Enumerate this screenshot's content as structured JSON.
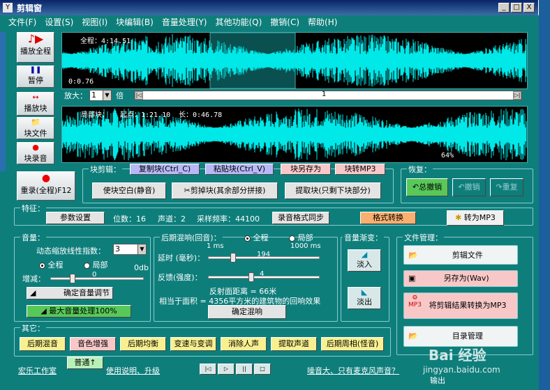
{
  "window": {
    "title": "剪辑窗",
    "app_icon": "Y",
    "min": "_",
    "max": "□",
    "close": "X"
  },
  "menu": [
    "文件(F)",
    "设置(S)",
    "视图(I)",
    "块编辑(B)",
    "音量处理(Y)",
    "其他功能(Q)",
    "撤销(C)",
    "帮助(H)"
  ],
  "side_buttons": {
    "play_all": "播放全程",
    "pause": "暂停",
    "play_block": "播放块",
    "block_file": "块文件",
    "block_record": "块录音"
  },
  "wave_full": {
    "total_label": "全程：4:14.51",
    "position": "0:0.76"
  },
  "zoom": {
    "label": "放大：",
    "value": "1",
    "unit": "倍",
    "scroll_value": "1"
  },
  "wave_block": {
    "label": "局部块：",
    "start_label": "起点：1:21.10",
    "length_label": "长：0:46.78",
    "percent": "64%"
  },
  "rerecord": "重录(全程)F12",
  "block_edit": {
    "label": "块剪辑：",
    "copy": "复制块(Ctrl_C)",
    "paste": "粘贴块(Ctrl_V)",
    "save_as": "块另存为",
    "to_mp3": "块转MP3",
    "blank": "使块空白(静音)",
    "cut": "剪掉块(其余部分拼接)",
    "extract": "提取块(只剩下块部分)"
  },
  "restore": {
    "label": "恢复：",
    "undo_all": "总撤销",
    "undo": "撤销",
    "redo": "重复"
  },
  "features": {
    "label": "特征：",
    "params_btn": "参数设置",
    "bits": "位数：16",
    "channels": "声道：2",
    "sample_rate": "采样频率：44100",
    "sync_btn": "录音格式同步",
    "format_btn": "格式转换",
    "mp3_btn": "转为MP3"
  },
  "volume": {
    "label": "音量：",
    "dyn_label": "动态缩放线性指数：",
    "dyn_value": "3",
    "all": "全程",
    "partial": "局部",
    "gain_label": "增减：",
    "gain_value": "0",
    "db_label": "0db",
    "confirm_btn": "确定音量调节",
    "max_btn": "最大音量处理100%"
  },
  "reverb": {
    "label": "后期混响(回音)：",
    "all": "全程",
    "partial": "局部",
    "min_ms": "1 ms",
    "max_ms": "1000 ms",
    "delay_label": "延时 (毫秒)：",
    "delay_value": "194",
    "feedback_label": "反馈(强度)：",
    "feedback_value": "4",
    "distance_text": "反射面距离 = 66米",
    "area_text": "相当于面积 = 4356平方米的建筑物的回响效果",
    "confirm_btn": "确定混响"
  },
  "fade": {
    "label": "音量渐变：",
    "fade_in": "淡入",
    "fade_out": "淡出"
  },
  "file_mgmt": {
    "label": "文件管理：",
    "cut_file": "剪辑文件",
    "save_wav": "另存为(Wav)",
    "convert_mp3": "将剪辑结果转换为MP3",
    "mp3_small": "MP3",
    "catalog": "目录管理"
  },
  "other": {
    "label": "其它：",
    "buttons": [
      "后期混音",
      "音色增强",
      "后期均衡",
      "变速与变调",
      "消除人声",
      "提取声道",
      "后期周相(怪音)"
    ]
  },
  "footer": {
    "studio": "宏乐工作室",
    "normal_btn": "普通↑",
    "manual": "使用说明、升级",
    "noise_link": "噪音大、只有麦克风声音？",
    "exit_label": "输出"
  },
  "watermark": {
    "logo": "Bai 经验",
    "url": "jingyan.baidu.com"
  },
  "colors": {
    "accent_wave": "#00e8e8",
    "background": "#0e7e7b"
  }
}
